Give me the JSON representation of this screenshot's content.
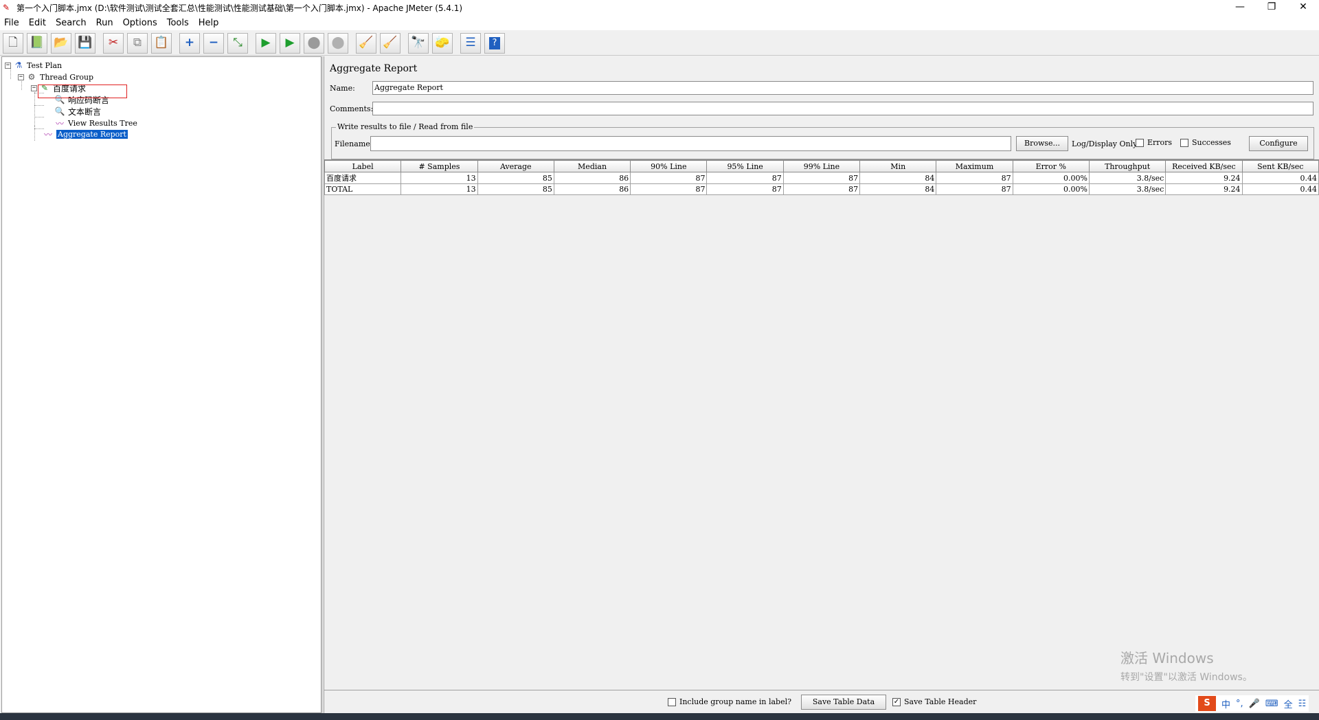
{
  "window": {
    "title": "第一个入门脚本.jmx (D:\\软件测试\\测试全套汇总\\性能测试\\性能测试基础\\第一个入门脚本.jmx) - Apache JMeter (5.4.1)",
    "minimize": "—",
    "restore": "❐",
    "close": "✕"
  },
  "menu": [
    "File",
    "Edit",
    "Search",
    "Run",
    "Options",
    "Tools",
    "Help"
  ],
  "toolbar": [
    {
      "icon": "new-icon",
      "glyph": "🗋"
    },
    {
      "icon": "templates-icon",
      "glyph": "📗"
    },
    {
      "icon": "open-icon",
      "glyph": "📂"
    },
    {
      "icon": "save-icon",
      "glyph": "💾"
    },
    {
      "icon": "cut-icon",
      "glyph": "✂"
    },
    {
      "icon": "copy-icon",
      "glyph": "⧉"
    },
    {
      "icon": "paste-icon",
      "glyph": "📋"
    },
    {
      "icon": "expand-icon",
      "glyph": "+"
    },
    {
      "icon": "collapse-icon",
      "glyph": "−"
    },
    {
      "icon": "toggle-icon",
      "glyph": "⤡"
    },
    {
      "icon": "start-icon",
      "glyph": "▶"
    },
    {
      "icon": "start-no-pause-icon",
      "glyph": "▶"
    },
    {
      "icon": "stop-icon",
      "glyph": "⬤"
    },
    {
      "icon": "shutdown-icon",
      "glyph": "⬤"
    },
    {
      "icon": "clear-icon",
      "glyph": "🧹"
    },
    {
      "icon": "clear-all-icon",
      "glyph": "🧹"
    },
    {
      "icon": "search-icon",
      "glyph": "🔭"
    },
    {
      "icon": "reset-search-icon",
      "glyph": "🧽"
    },
    {
      "icon": "function-helper-icon",
      "glyph": "☰"
    },
    {
      "icon": "help-icon",
      "glyph": "?"
    }
  ],
  "tree": {
    "test_plan": "Test Plan",
    "thread_group": "Thread Group",
    "sampler": "百度请求",
    "assert1": "响应码断言",
    "assert2": "文本断言",
    "view_results": "View Results Tree",
    "aggregate": "Aggregate Report"
  },
  "panel": {
    "title": "Aggregate Report",
    "name_label": "Name:",
    "name_value": "Aggregate Report",
    "comments_label": "Comments:",
    "comments_value": "",
    "write_results_legend": "Write results to file / Read from file",
    "filename_label": "Filename",
    "filename_value": "",
    "browse": "Browse...",
    "log_display": "Log/Display Only:",
    "errors": "Errors",
    "successes": "Successes",
    "configure": "Configure"
  },
  "table": {
    "headers": [
      "Label",
      "# Samples",
      "Average",
      "Median",
      "90% Line",
      "95% Line",
      "99% Line",
      "Min",
      "Maximum",
      "Error %",
      "Throughput",
      "Received KB/sec",
      "Sent KB/sec"
    ],
    "rows": [
      [
        "百度请求",
        "13",
        "85",
        "86",
        "87",
        "87",
        "87",
        "84",
        "87",
        "0.00%",
        "3.8/sec",
        "9.24",
        "0.44"
      ],
      [
        "TOTAL",
        "13",
        "85",
        "86",
        "87",
        "87",
        "87",
        "84",
        "87",
        "0.00%",
        "3.8/sec",
        "9.24",
        "0.44"
      ]
    ]
  },
  "bottom": {
    "include_group": "Include group name in label?",
    "include_group_checked": false,
    "save_table_data": "Save Table Data",
    "save_table_header": "Save Table Header",
    "save_table_header_checked": true
  },
  "watermark": {
    "line1": "激活 Windows",
    "line2": "转到\"设置\"以激活 Windows。"
  },
  "ime": [
    "S",
    "中",
    "°,",
    "🎤",
    "⌨",
    "全",
    "☷"
  ]
}
